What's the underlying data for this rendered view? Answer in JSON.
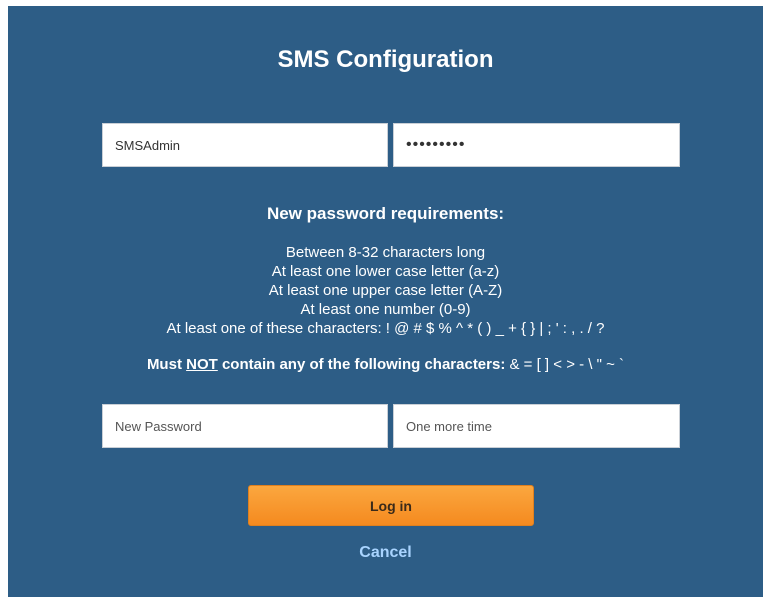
{
  "title": "SMS Configuration",
  "login": {
    "username_value": "SMSAdmin",
    "password_value": "•••••••••"
  },
  "requirements": {
    "heading": "New password requirements:",
    "items": [
      "Between 8-32 characters long",
      "At least one lower case letter (a-z)",
      "At least one upper case letter (A-Z)",
      "At least one number (0-9)",
      "At least one of these characters: ! @ # $ % ^ * ( ) _ + { } | ; ' : , . / ?"
    ],
    "forbidden_prefix": "Must",
    "forbidden_not": "NOT",
    "forbidden_middle": "contain any of the following characters:",
    "forbidden_chars": "& = [ ] < > - \\ \" ~ `"
  },
  "new_password": {
    "placeholder": "New Password",
    "confirm_placeholder": "One more time"
  },
  "buttons": {
    "login_label": "Log in",
    "cancel_label": "Cancel"
  }
}
